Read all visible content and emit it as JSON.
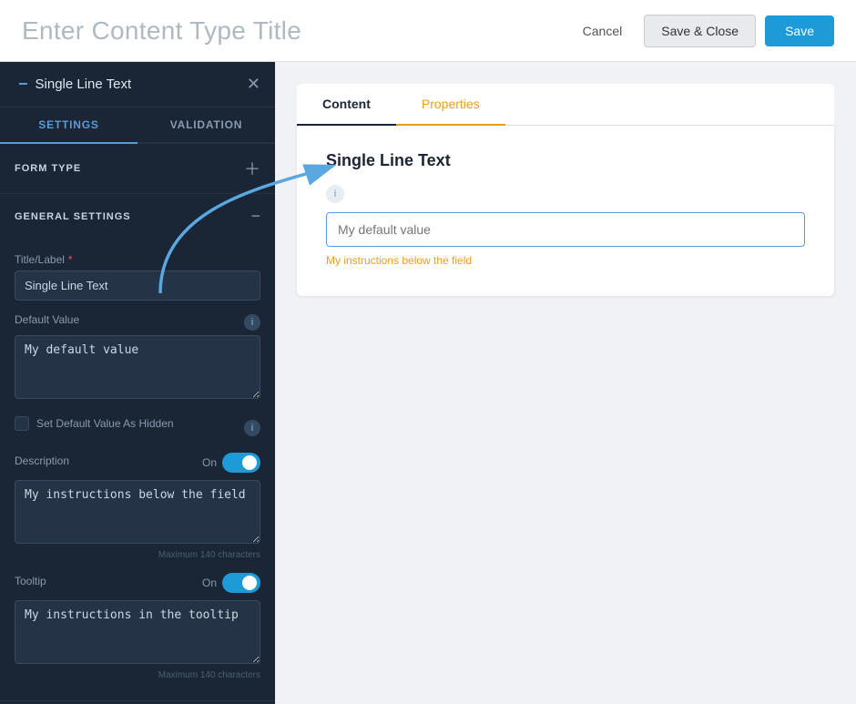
{
  "header": {
    "title": "Enter Content Type Title",
    "cancel_label": "Cancel",
    "save_close_label": "Save & Close",
    "save_label": "Save"
  },
  "sidebar": {
    "panel_title": "Single Line Text",
    "tabs": [
      {
        "label": "SETTINGS",
        "active": true
      },
      {
        "label": "VALIDATION",
        "active": false
      }
    ],
    "sections": {
      "form_type": {
        "title": "FORM TYPE",
        "expanded": false
      },
      "general_settings": {
        "title": "GENERAL SETTINGS",
        "expanded": true
      }
    },
    "fields": {
      "title_label_label": "Title/Label",
      "title_label_value": "Single Line Text",
      "default_value_label": "Default Value",
      "default_value_value": "My default value",
      "set_default_hidden_label": "Set Default Value As Hidden",
      "description_label": "Description",
      "description_on_label": "On",
      "description_value": "My instructions below the field",
      "description_char_limit": "Maximum 140 characters",
      "tooltip_label": "Tooltip",
      "tooltip_on_label": "On",
      "tooltip_value": "My instructions in the tooltip",
      "tooltip_char_limit": "Maximum 140 characters"
    }
  },
  "preview": {
    "tabs": [
      {
        "label": "Content",
        "active": true
      },
      {
        "label": "Properties",
        "active": false,
        "color": "orange"
      }
    ],
    "field_title": "Single Line Text",
    "input_placeholder": "My default value",
    "instruction_text": "My instructions below the field"
  }
}
